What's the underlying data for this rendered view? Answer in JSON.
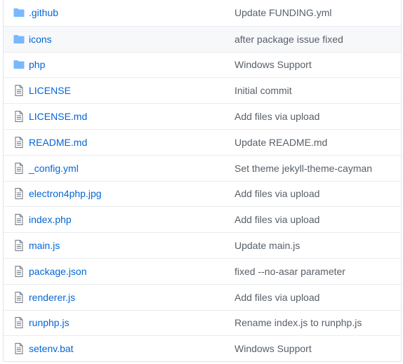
{
  "colors": {
    "link": "#0366d6",
    "message": "#586069",
    "folder_icon": "#79b8ff",
    "file_icon": "#6a737d",
    "hover_row": "#f6f8fa",
    "border": "#eaecef"
  },
  "rows": [
    {
      "type": "folder",
      "icon": "folder-icon",
      "name": ".github",
      "message": "Update FUNDING.yml"
    },
    {
      "type": "folder",
      "icon": "folder-icon",
      "name": "icons",
      "message": "after package issue fixed"
    },
    {
      "type": "folder",
      "icon": "folder-icon",
      "name": "php",
      "message": "Windows Support"
    },
    {
      "type": "file",
      "icon": "file-icon",
      "name": "LICENSE",
      "message": "Initial commit"
    },
    {
      "type": "file",
      "icon": "file-icon",
      "name": "LICENSE.md",
      "message": "Add files via upload"
    },
    {
      "type": "file",
      "icon": "file-icon",
      "name": "README.md",
      "message": "Update README.md"
    },
    {
      "type": "file",
      "icon": "file-icon",
      "name": "_config.yml",
      "message": "Set theme jekyll-theme-cayman"
    },
    {
      "type": "file",
      "icon": "file-icon",
      "name": "electron4php.jpg",
      "message": "Add files via upload"
    },
    {
      "type": "file",
      "icon": "file-icon",
      "name": "index.php",
      "message": "Add files via upload"
    },
    {
      "type": "file",
      "icon": "file-icon",
      "name": "main.js",
      "message": "Update main.js"
    },
    {
      "type": "file",
      "icon": "file-icon",
      "name": "package.json",
      "message": "fixed --no-asar parameter"
    },
    {
      "type": "file",
      "icon": "file-icon",
      "name": "renderer.js",
      "message": "Add files via upload"
    },
    {
      "type": "file",
      "icon": "file-icon",
      "name": "runphp.js",
      "message": "Rename index.js to runphp.js"
    },
    {
      "type": "file",
      "icon": "file-icon",
      "name": "setenv.bat",
      "message": "Windows Support"
    }
  ]
}
